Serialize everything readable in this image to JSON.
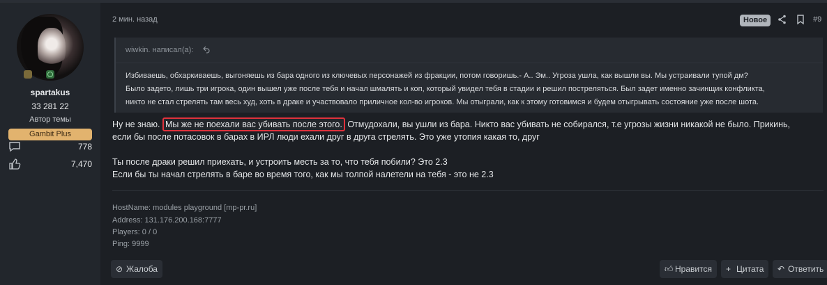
{
  "user": {
    "name": "spartakus",
    "score": "33 281 22",
    "role": "Автор темы",
    "badge": "Gambit Plus",
    "stats": [
      {
        "icon": "message-icon",
        "value": "778"
      },
      {
        "icon": "thumbs-up-icon",
        "value": "7,470"
      }
    ]
  },
  "post": {
    "time": "2 мин. назад",
    "new_label": "Новое",
    "number": "#9",
    "quote": {
      "author": "wiwkin. написал(а):",
      "lines": [
        "Избиваешь, обхаркиваешь, выгоняешь из бара одного из ключевых персонажей из фракции, потом говоришь.- А.. Эм.. Угроза ушла, как вышли вы. Мы устраивали тупой дм?",
        "Было задето, лишь три игрока, один вышел уже после тебя и начал шмалять и коп, который увидел тебя в стадии и решил постреляться. Был задет именно зачинщик конфликта,",
        "никто не стал стрелять там весь худ, хоть в драке и участвовало приличное кол-во игроков. Мы отыграли, как к этому готовимся и будем отыгрывать состояние уже после шота."
      ]
    },
    "body": {
      "line1_prefix": "Ну не знаю.",
      "line1_highlight": "Мы же не поехали вас убивать после этого.",
      "line1_suffix": "Отмудохали, вы ушли из бара. Никто вас убивать не собирался, т.е угрозы жизни никакой не было. Прикинь,",
      "line2": "если бы после потасовок в барах в ИРЛ люди ехали друг в друга стрелять. Это уже утопия какая то, друг",
      "line3": "Ты после драки решил приехать, и устроить месть за то, что тебя побили? Это 2.3",
      "line4": "Если бы ты начал стрелять в баре во время того, как мы толпой налетели на тебя - это не 2.3"
    },
    "signature": [
      "HostName: modules playground [mp-pr.ru]",
      "Address: 131.176.200.168:7777",
      "Players: 0 / 0",
      "Ping: 9999"
    ],
    "actions": {
      "report": "Жалоба",
      "like": "Нравится",
      "quote": "Цитата",
      "reply": "Ответить"
    }
  }
}
